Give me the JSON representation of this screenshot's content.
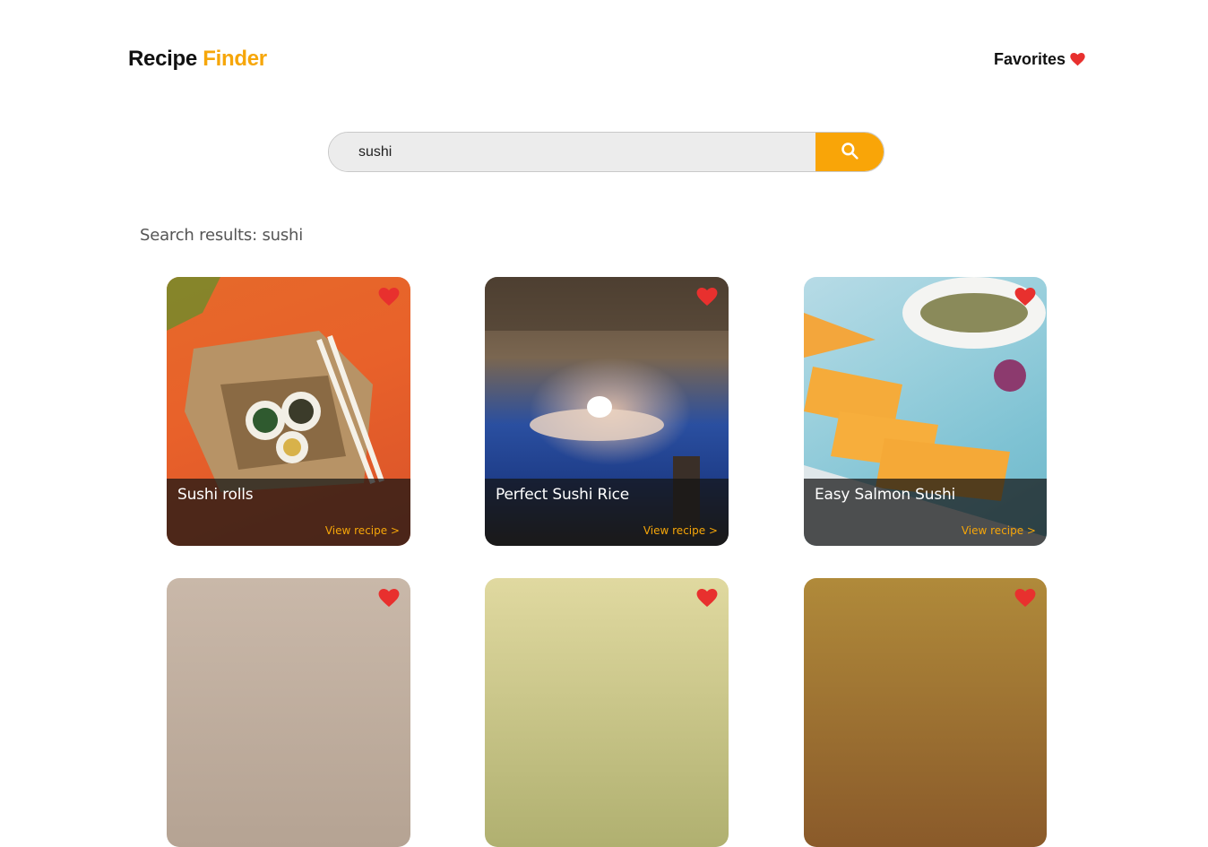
{
  "header": {
    "logo_part1": "Recipe",
    "logo_part2": "Finder",
    "favorites_label": "Favorites"
  },
  "search": {
    "value": "sushi",
    "placeholder": ""
  },
  "results": {
    "title": "Search results: sushi",
    "cards": [
      {
        "title": "Sushi rolls",
        "link": "View recipe >"
      },
      {
        "title": "Perfect Sushi Rice",
        "link": "View recipe >"
      },
      {
        "title": "Easy Salmon Sushi",
        "link": "View recipe >"
      }
    ]
  },
  "colors": {
    "accent": "#f6a609",
    "heart": "#e8302e"
  },
  "icons": [
    "heart-icon",
    "search-icon"
  ]
}
